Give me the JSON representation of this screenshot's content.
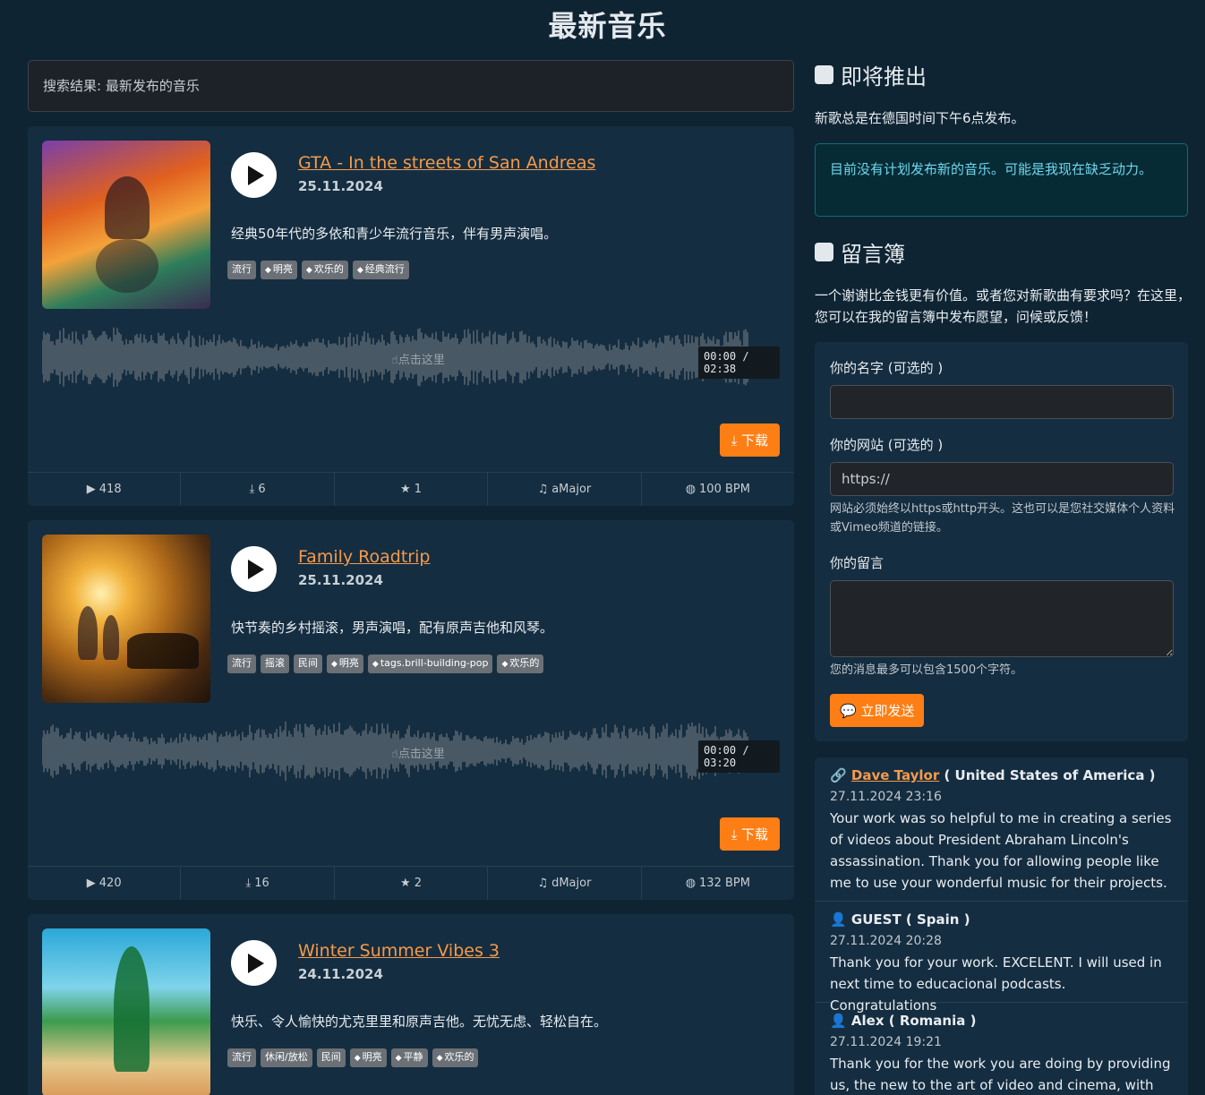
{
  "page": {
    "title": "最新音乐"
  },
  "search": {
    "text": "搜索结果: 最新发布的音乐"
  },
  "songs": [
    {
      "title": "GTA - In the streets of San Andreas",
      "date": "25.11.2024",
      "description": "经典50年代的多依和青少年流行音乐，伴有男声演唱。",
      "tags": [
        {
          "label": "流行",
          "icon": false
        },
        {
          "label": "明亮",
          "icon": true
        },
        {
          "label": "欢乐的",
          "icon": true
        },
        {
          "label": "经典流行",
          "icon": true
        }
      ],
      "wave_hint": "点击这里",
      "time": "00:00  /  02:38",
      "download": "下载",
      "plays": "418",
      "downloads": "6",
      "stars": "1",
      "key": "aMajor",
      "bpm": "100 BPM"
    },
    {
      "title": "Family Roadtrip",
      "date": "25.11.2024",
      "description": "快节奏的乡村摇滚，男声演唱，配有原声吉他和风琴。",
      "tags": [
        {
          "label": "流行",
          "icon": false
        },
        {
          "label": "摇滚",
          "icon": false
        },
        {
          "label": "民间",
          "icon": false
        },
        {
          "label": "明亮",
          "icon": true
        },
        {
          "label": "tags.brill-building-pop",
          "icon": true
        },
        {
          "label": "欢乐的",
          "icon": true
        }
      ],
      "wave_hint": "点击这里",
      "time": "00:00  /  03:20",
      "download": "下载",
      "plays": "420",
      "downloads": "16",
      "stars": "2",
      "key": "dMajor",
      "bpm": "132 BPM"
    },
    {
      "title": "Winter Summer Vibes 3",
      "date": "24.11.2024",
      "description": "快乐、令人愉快的尤克里里和原声吉他。无忧无虑、轻松自在。",
      "tags": [
        {
          "label": "流行",
          "icon": false
        },
        {
          "label": "休闲/放松",
          "icon": false
        },
        {
          "label": "民间",
          "icon": false
        },
        {
          "label": "明亮",
          "icon": true
        },
        {
          "label": "平静",
          "icon": true
        },
        {
          "label": "欢乐的",
          "icon": true
        }
      ]
    }
  ],
  "sidebar": {
    "upcoming": {
      "heading": "即将推出",
      "text": "新歌总是在德国时间下午6点发布。",
      "notice": "目前没有计划发布新的音乐。可能是我现在缺乏动力。"
    },
    "guestbook": {
      "heading": "留言簿",
      "intro": "一个谢谢比金钱更有价值。或者您对新歌曲有要求吗？在这里，您可以在我的留言簿中发布愿望，问候或反馈！",
      "form": {
        "name_label": "你的名字 (可选的 )",
        "name_value": "",
        "website_label": "你的网站 (可选的 )",
        "website_value": "https://",
        "website_help": "网站必须始终以https或http开头。这也可以是您社交媒体个人资料或Vimeo频道的链接。",
        "message_label": "你的留言",
        "message_value": "",
        "message_help": "您的消息最多可以包含1500个字符。",
        "send_label": "立即发送"
      },
      "entries": [
        {
          "icon": "link-icon",
          "name": "Dave Taylor",
          "country": " ( United States of America )",
          "date": "27.11.2024 23:16",
          "text": "Your work was so helpful to me in creating a series of videos about President Abraham Lincoln's assassination. Thank you for allowing people like me to use your wonderful music for their projects."
        },
        {
          "icon": "user-icon",
          "name": "GUEST",
          "country": " ( Spain )",
          "date": "27.11.2024 20:28",
          "text": "Thank you for your work. EXCELENT. I will used in next time to educacional podcasts. Congratulations"
        },
        {
          "icon": "user-icon",
          "name": "Alex",
          "country": " ( Romania )",
          "date": "27.11.2024 19:21",
          "text": "Thank you for the work you are doing by providing us, the new to the art of video and cinema, with the"
        }
      ]
    }
  },
  "colors": {
    "accent": "#fd7e14",
    "link": "#f59a4a",
    "background": "#0f2433",
    "card": "#152d40"
  }
}
